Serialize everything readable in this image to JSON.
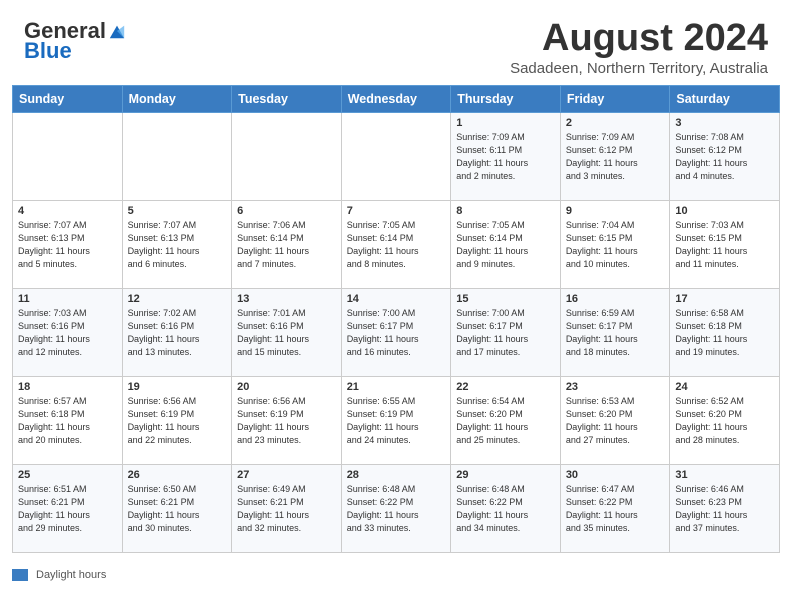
{
  "header": {
    "logo_general": "General",
    "logo_blue": "Blue",
    "month_title": "August 2024",
    "subtitle": "Sadadeen, Northern Territory, Australia"
  },
  "days_of_week": [
    "Sunday",
    "Monday",
    "Tuesday",
    "Wednesday",
    "Thursday",
    "Friday",
    "Saturday"
  ],
  "legend_label": "Daylight hours",
  "weeks": [
    [
      {
        "day": "",
        "info": ""
      },
      {
        "day": "",
        "info": ""
      },
      {
        "day": "",
        "info": ""
      },
      {
        "day": "",
        "info": ""
      },
      {
        "day": "1",
        "info": "Sunrise: 7:09 AM\nSunset: 6:11 PM\nDaylight: 11 hours\nand 2 minutes."
      },
      {
        "day": "2",
        "info": "Sunrise: 7:09 AM\nSunset: 6:12 PM\nDaylight: 11 hours\nand 3 minutes."
      },
      {
        "day": "3",
        "info": "Sunrise: 7:08 AM\nSunset: 6:12 PM\nDaylight: 11 hours\nand 4 minutes."
      }
    ],
    [
      {
        "day": "4",
        "info": "Sunrise: 7:07 AM\nSunset: 6:13 PM\nDaylight: 11 hours\nand 5 minutes."
      },
      {
        "day": "5",
        "info": "Sunrise: 7:07 AM\nSunset: 6:13 PM\nDaylight: 11 hours\nand 6 minutes."
      },
      {
        "day": "6",
        "info": "Sunrise: 7:06 AM\nSunset: 6:14 PM\nDaylight: 11 hours\nand 7 minutes."
      },
      {
        "day": "7",
        "info": "Sunrise: 7:05 AM\nSunset: 6:14 PM\nDaylight: 11 hours\nand 8 minutes."
      },
      {
        "day": "8",
        "info": "Sunrise: 7:05 AM\nSunset: 6:14 PM\nDaylight: 11 hours\nand 9 minutes."
      },
      {
        "day": "9",
        "info": "Sunrise: 7:04 AM\nSunset: 6:15 PM\nDaylight: 11 hours\nand 10 minutes."
      },
      {
        "day": "10",
        "info": "Sunrise: 7:03 AM\nSunset: 6:15 PM\nDaylight: 11 hours\nand 11 minutes."
      }
    ],
    [
      {
        "day": "11",
        "info": "Sunrise: 7:03 AM\nSunset: 6:16 PM\nDaylight: 11 hours\nand 12 minutes."
      },
      {
        "day": "12",
        "info": "Sunrise: 7:02 AM\nSunset: 6:16 PM\nDaylight: 11 hours\nand 13 minutes."
      },
      {
        "day": "13",
        "info": "Sunrise: 7:01 AM\nSunset: 6:16 PM\nDaylight: 11 hours\nand 15 minutes."
      },
      {
        "day": "14",
        "info": "Sunrise: 7:00 AM\nSunset: 6:17 PM\nDaylight: 11 hours\nand 16 minutes."
      },
      {
        "day": "15",
        "info": "Sunrise: 7:00 AM\nSunset: 6:17 PM\nDaylight: 11 hours\nand 17 minutes."
      },
      {
        "day": "16",
        "info": "Sunrise: 6:59 AM\nSunset: 6:17 PM\nDaylight: 11 hours\nand 18 minutes."
      },
      {
        "day": "17",
        "info": "Sunrise: 6:58 AM\nSunset: 6:18 PM\nDaylight: 11 hours\nand 19 minutes."
      }
    ],
    [
      {
        "day": "18",
        "info": "Sunrise: 6:57 AM\nSunset: 6:18 PM\nDaylight: 11 hours\nand 20 minutes."
      },
      {
        "day": "19",
        "info": "Sunrise: 6:56 AM\nSunset: 6:19 PM\nDaylight: 11 hours\nand 22 minutes."
      },
      {
        "day": "20",
        "info": "Sunrise: 6:56 AM\nSunset: 6:19 PM\nDaylight: 11 hours\nand 23 minutes."
      },
      {
        "day": "21",
        "info": "Sunrise: 6:55 AM\nSunset: 6:19 PM\nDaylight: 11 hours\nand 24 minutes."
      },
      {
        "day": "22",
        "info": "Sunrise: 6:54 AM\nSunset: 6:20 PM\nDaylight: 11 hours\nand 25 minutes."
      },
      {
        "day": "23",
        "info": "Sunrise: 6:53 AM\nSunset: 6:20 PM\nDaylight: 11 hours\nand 27 minutes."
      },
      {
        "day": "24",
        "info": "Sunrise: 6:52 AM\nSunset: 6:20 PM\nDaylight: 11 hours\nand 28 minutes."
      }
    ],
    [
      {
        "day": "25",
        "info": "Sunrise: 6:51 AM\nSunset: 6:21 PM\nDaylight: 11 hours\nand 29 minutes."
      },
      {
        "day": "26",
        "info": "Sunrise: 6:50 AM\nSunset: 6:21 PM\nDaylight: 11 hours\nand 30 minutes."
      },
      {
        "day": "27",
        "info": "Sunrise: 6:49 AM\nSunset: 6:21 PM\nDaylight: 11 hours\nand 32 minutes."
      },
      {
        "day": "28",
        "info": "Sunrise: 6:48 AM\nSunset: 6:22 PM\nDaylight: 11 hours\nand 33 minutes."
      },
      {
        "day": "29",
        "info": "Sunrise: 6:48 AM\nSunset: 6:22 PM\nDaylight: 11 hours\nand 34 minutes."
      },
      {
        "day": "30",
        "info": "Sunrise: 6:47 AM\nSunset: 6:22 PM\nDaylight: 11 hours\nand 35 minutes."
      },
      {
        "day": "31",
        "info": "Sunrise: 6:46 AM\nSunset: 6:23 PM\nDaylight: 11 hours\nand 37 minutes."
      }
    ]
  ]
}
